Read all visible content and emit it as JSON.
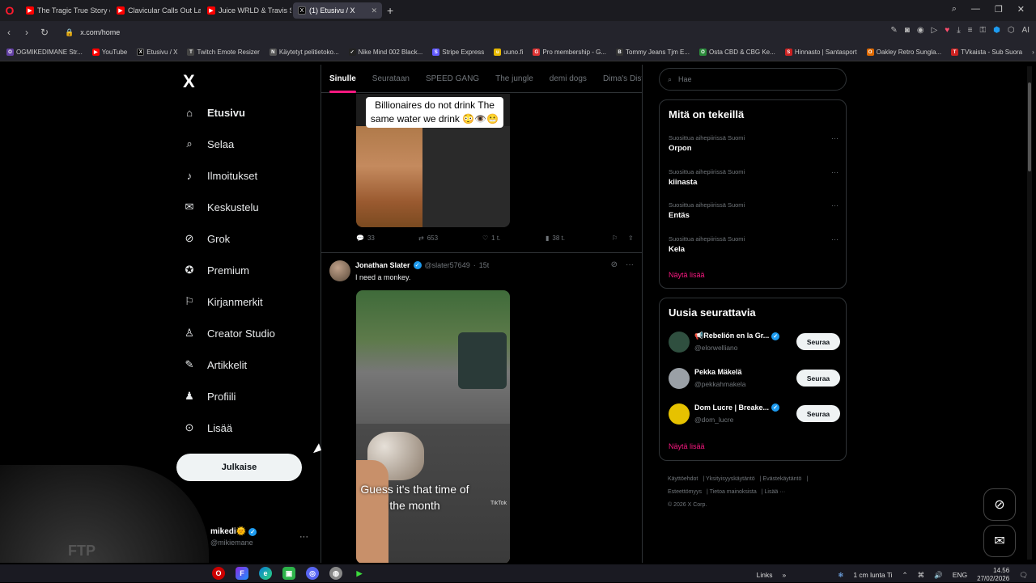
{
  "browser": {
    "tabs": [
      {
        "title": "The Tragic True Story of Ju",
        "color": "#ff0000",
        "active": false
      },
      {
        "title": "Clavicular Calls Out Larry",
        "color": "#ff0000",
        "active": false
      },
      {
        "title": "Juice WRLD & Travis Scott",
        "color": "#ff0000",
        "active": false
      },
      {
        "title": "(1) Etusivu / X",
        "color": "#000000",
        "active": true
      }
    ],
    "url": "x.com/home",
    "bookmarks": [
      {
        "label": "OGMIKEDIMANE Str...",
        "icon": "O",
        "color": "#6441a5"
      },
      {
        "label": "YouTube",
        "icon": "▶",
        "color": "#ff0000"
      },
      {
        "label": "Etusivu / X",
        "icon": "X",
        "color": "#000000"
      },
      {
        "label": "Twitch Emote Resizer",
        "icon": "T",
        "color": "#444"
      },
      {
        "label": "Käytetyt pelitietoko...",
        "icon": "N",
        "color": "#555"
      },
      {
        "label": "Nike Mind 002 Black...",
        "icon": "✓",
        "color": "#222"
      },
      {
        "label": "Stripe Express",
        "icon": "S",
        "color": "#635bff"
      },
      {
        "label": "uuno.fi",
        "icon": "u",
        "color": "#e6b800"
      },
      {
        "label": "Pro membership - G...",
        "icon": "G",
        "color": "#d33"
      },
      {
        "label": "Tommy Jeans Tjm E...",
        "icon": "B",
        "color": "#333"
      },
      {
        "label": "Osta CBD & CBG Ke...",
        "icon": "O",
        "color": "#2a8a3a"
      },
      {
        "label": "Hinnasto | Santasport",
        "icon": "S",
        "color": "#c22"
      },
      {
        "label": "Oakley Retro Sungla...",
        "icon": "O",
        "color": "#e06a00"
      },
      {
        "label": "TVkaista - Sub Suora",
        "icon": "T",
        "color": "#c22"
      }
    ]
  },
  "nav": {
    "logo": "X",
    "items": [
      {
        "label": "Etusivu",
        "icon": "home-icon",
        "glyph": "⌂",
        "bold": true
      },
      {
        "label": "Selaa",
        "icon": "search-icon",
        "glyph": "⌕",
        "bold": false
      },
      {
        "label": "Ilmoitukset",
        "icon": "bell-icon",
        "glyph": "🔔",
        "bold": false
      },
      {
        "label": "Keskustelu",
        "icon": "mail-icon",
        "glyph": "✉",
        "bold": false
      },
      {
        "label": "Grok",
        "icon": "grok-icon",
        "glyph": "⊘",
        "bold": false
      },
      {
        "label": "Premium",
        "icon": "premium-icon",
        "glyph": "✓",
        "bold": false
      },
      {
        "label": "Kirjanmerkit",
        "icon": "bookmark-icon",
        "glyph": "🔖",
        "bold": false
      },
      {
        "label": "Creator Studio",
        "icon": "creator-studio-icon",
        "glyph": "♙",
        "bold": false
      },
      {
        "label": "Artikkelit",
        "icon": "articles-icon",
        "glyph": "✎",
        "bold": false
      },
      {
        "label": "Profiili",
        "icon": "profile-icon",
        "glyph": "👤",
        "bold": false
      },
      {
        "label": "Lisää",
        "icon": "more-icon",
        "glyph": "⋯",
        "bold": false
      }
    ],
    "post_button": "Julkaise",
    "account": {
      "name": "mikedi🌞",
      "handle": "@mikiemane"
    }
  },
  "feed": {
    "tabs": [
      {
        "label": "Sinulle",
        "active": true
      },
      {
        "label": "Seurataan",
        "active": false
      },
      {
        "label": "SPEED GANG",
        "active": false
      },
      {
        "label": "The jungle",
        "active": false
      },
      {
        "label": "demi dogs",
        "active": false
      },
      {
        "label": "Dima's Dist",
        "active": false
      }
    ],
    "tweet1": {
      "caption": "Billionaires do not drink The same water we drink 😳👁️😬",
      "replies": "33",
      "reposts": "653",
      "likes": "1 t.",
      "views": "38 t."
    },
    "tweet2": {
      "name": "Jonathan Slater",
      "handle": "@slater57649",
      "time": "15t",
      "text": "I need a monkey.",
      "caption": "Guess it's that time of the month",
      "watermark": "TikTok"
    }
  },
  "right": {
    "search_placeholder": "Hae",
    "trends_title": "Mitä on tekeillä",
    "trends": [
      {
        "context": "Suosittua aihepiirissä Suomi",
        "title": "Orpon"
      },
      {
        "context": "Suosittua aihepiirissä Suomi",
        "title": "kiinasta"
      },
      {
        "context": "Suosittua aihepiirissä Suomi",
        "title": "Entäs"
      },
      {
        "context": "Suosittua aihepiirissä Suomi",
        "title": "Kela"
      }
    ],
    "show_more": "Näytä lisää",
    "who_title": "Uusia seurattavia",
    "who": [
      {
        "name": "📢Rebelión en la Gr...",
        "handle": "@elorwelliano",
        "verified": true,
        "button": "Seuraa",
        "avatar_color": "#2f4f3f"
      },
      {
        "name": "Pekka Mäkelä",
        "handle": "@pekkahmakela",
        "verified": false,
        "button": "Seuraa",
        "avatar_color": "#9aa0a6"
      },
      {
        "name": "Dom Lucre | Breake...",
        "handle": "@dom_lucre",
        "verified": true,
        "button": "Seuraa",
        "avatar_color": "#e6c200"
      }
    ],
    "footer": [
      "Käyttöehdot",
      "Yksityisyyskäytäntö",
      "Evästekäytäntö",
      "Esteettömyys",
      "Tietoa mainoksista",
      "Lisää ···",
      "© 2026 X Corp."
    ]
  },
  "taskbar": {
    "links_label": "Links",
    "weather": "1 cm lunta Ti",
    "lang": "ENG",
    "time": "14.56",
    "date": "27/02/2026"
  },
  "colors": {
    "accent": "#f91880",
    "verified": "#1d9bf0"
  }
}
